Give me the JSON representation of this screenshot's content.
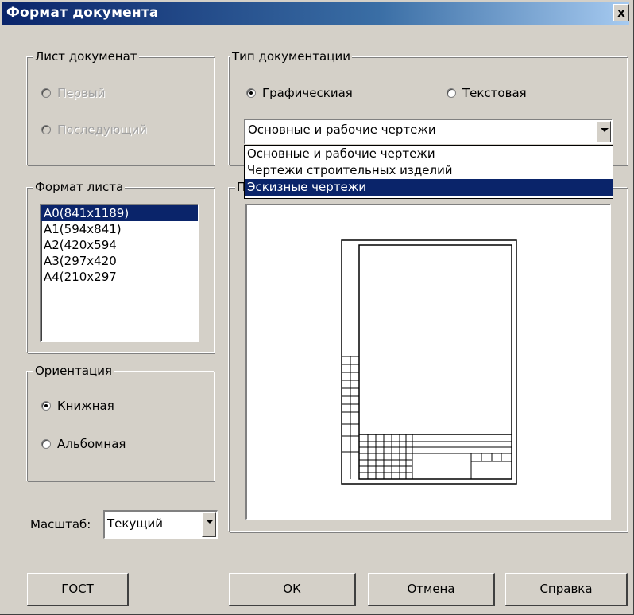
{
  "window": {
    "title": "Формат документа",
    "close_label": "x"
  },
  "sheet_group": {
    "legend": "Лист докуменат",
    "options": [
      {
        "label": "Первый",
        "checked": false,
        "disabled": true
      },
      {
        "label": "Последующий",
        "checked": false,
        "disabled": true
      }
    ]
  },
  "doc_type_group": {
    "legend": "Тип документации",
    "options": [
      {
        "label": "Графическиая",
        "checked": true
      },
      {
        "label": "Текстовая",
        "checked": false
      }
    ],
    "combo_value": "Основные и рабочие чертежи",
    "dropdown_items": [
      "Основные и рабочие чертежи",
      "Чертежи строительных изделий",
      "Эскизные чертежи"
    ],
    "dropdown_selected_index": 2
  },
  "format_group": {
    "legend": "Формат листа",
    "items": [
      "А0(841х1189)",
      "А1(594х841)",
      "А2(420х594",
      "А3(297х420",
      "А4(210х297"
    ],
    "selected_index": 0
  },
  "orientation_group": {
    "legend": "Ориентация",
    "options": [
      {
        "label": "Книжная",
        "checked": true
      },
      {
        "label": "Альбомная",
        "checked": false
      }
    ]
  },
  "preview_group": {
    "legend": "П"
  },
  "scale": {
    "label": "Масштаб:",
    "value": "Текущий"
  },
  "buttons": {
    "gost": "ГОСТ",
    "ok": "ОК",
    "cancel": "Отмена",
    "help": "Справка"
  },
  "colors": {
    "title_bar": "#0a246a",
    "selection": "#0a246a",
    "face": "#d4d0c8"
  }
}
